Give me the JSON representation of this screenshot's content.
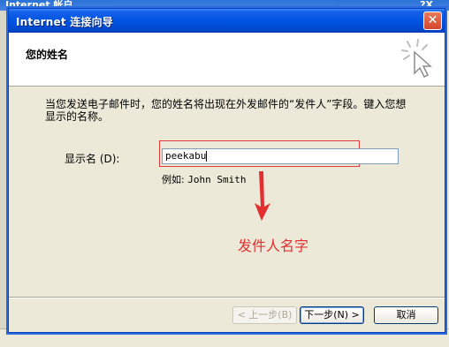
{
  "background": {
    "title": "Internet 帐户",
    "buttons": "?X"
  },
  "dialog": {
    "title": "Internet 连接向导",
    "close_label": "✕",
    "header_title": "您的姓名",
    "instruction": "当您发送电子邮件时，您的姓名将出现在外发邮件的“发件人”字段。键入您想显示的名称。",
    "display_name_label": "显示名 (D):",
    "display_name_value": "peekabu",
    "example_prefix": "例如:",
    "example_name": "John Smith",
    "annotation": "发件人名字",
    "buttons": {
      "back": "< 上一步(B)",
      "next": "下一步(N) >",
      "cancel": "取消"
    }
  },
  "colors": {
    "annotation": "#e03030",
    "titlebar": "#0054e3"
  }
}
